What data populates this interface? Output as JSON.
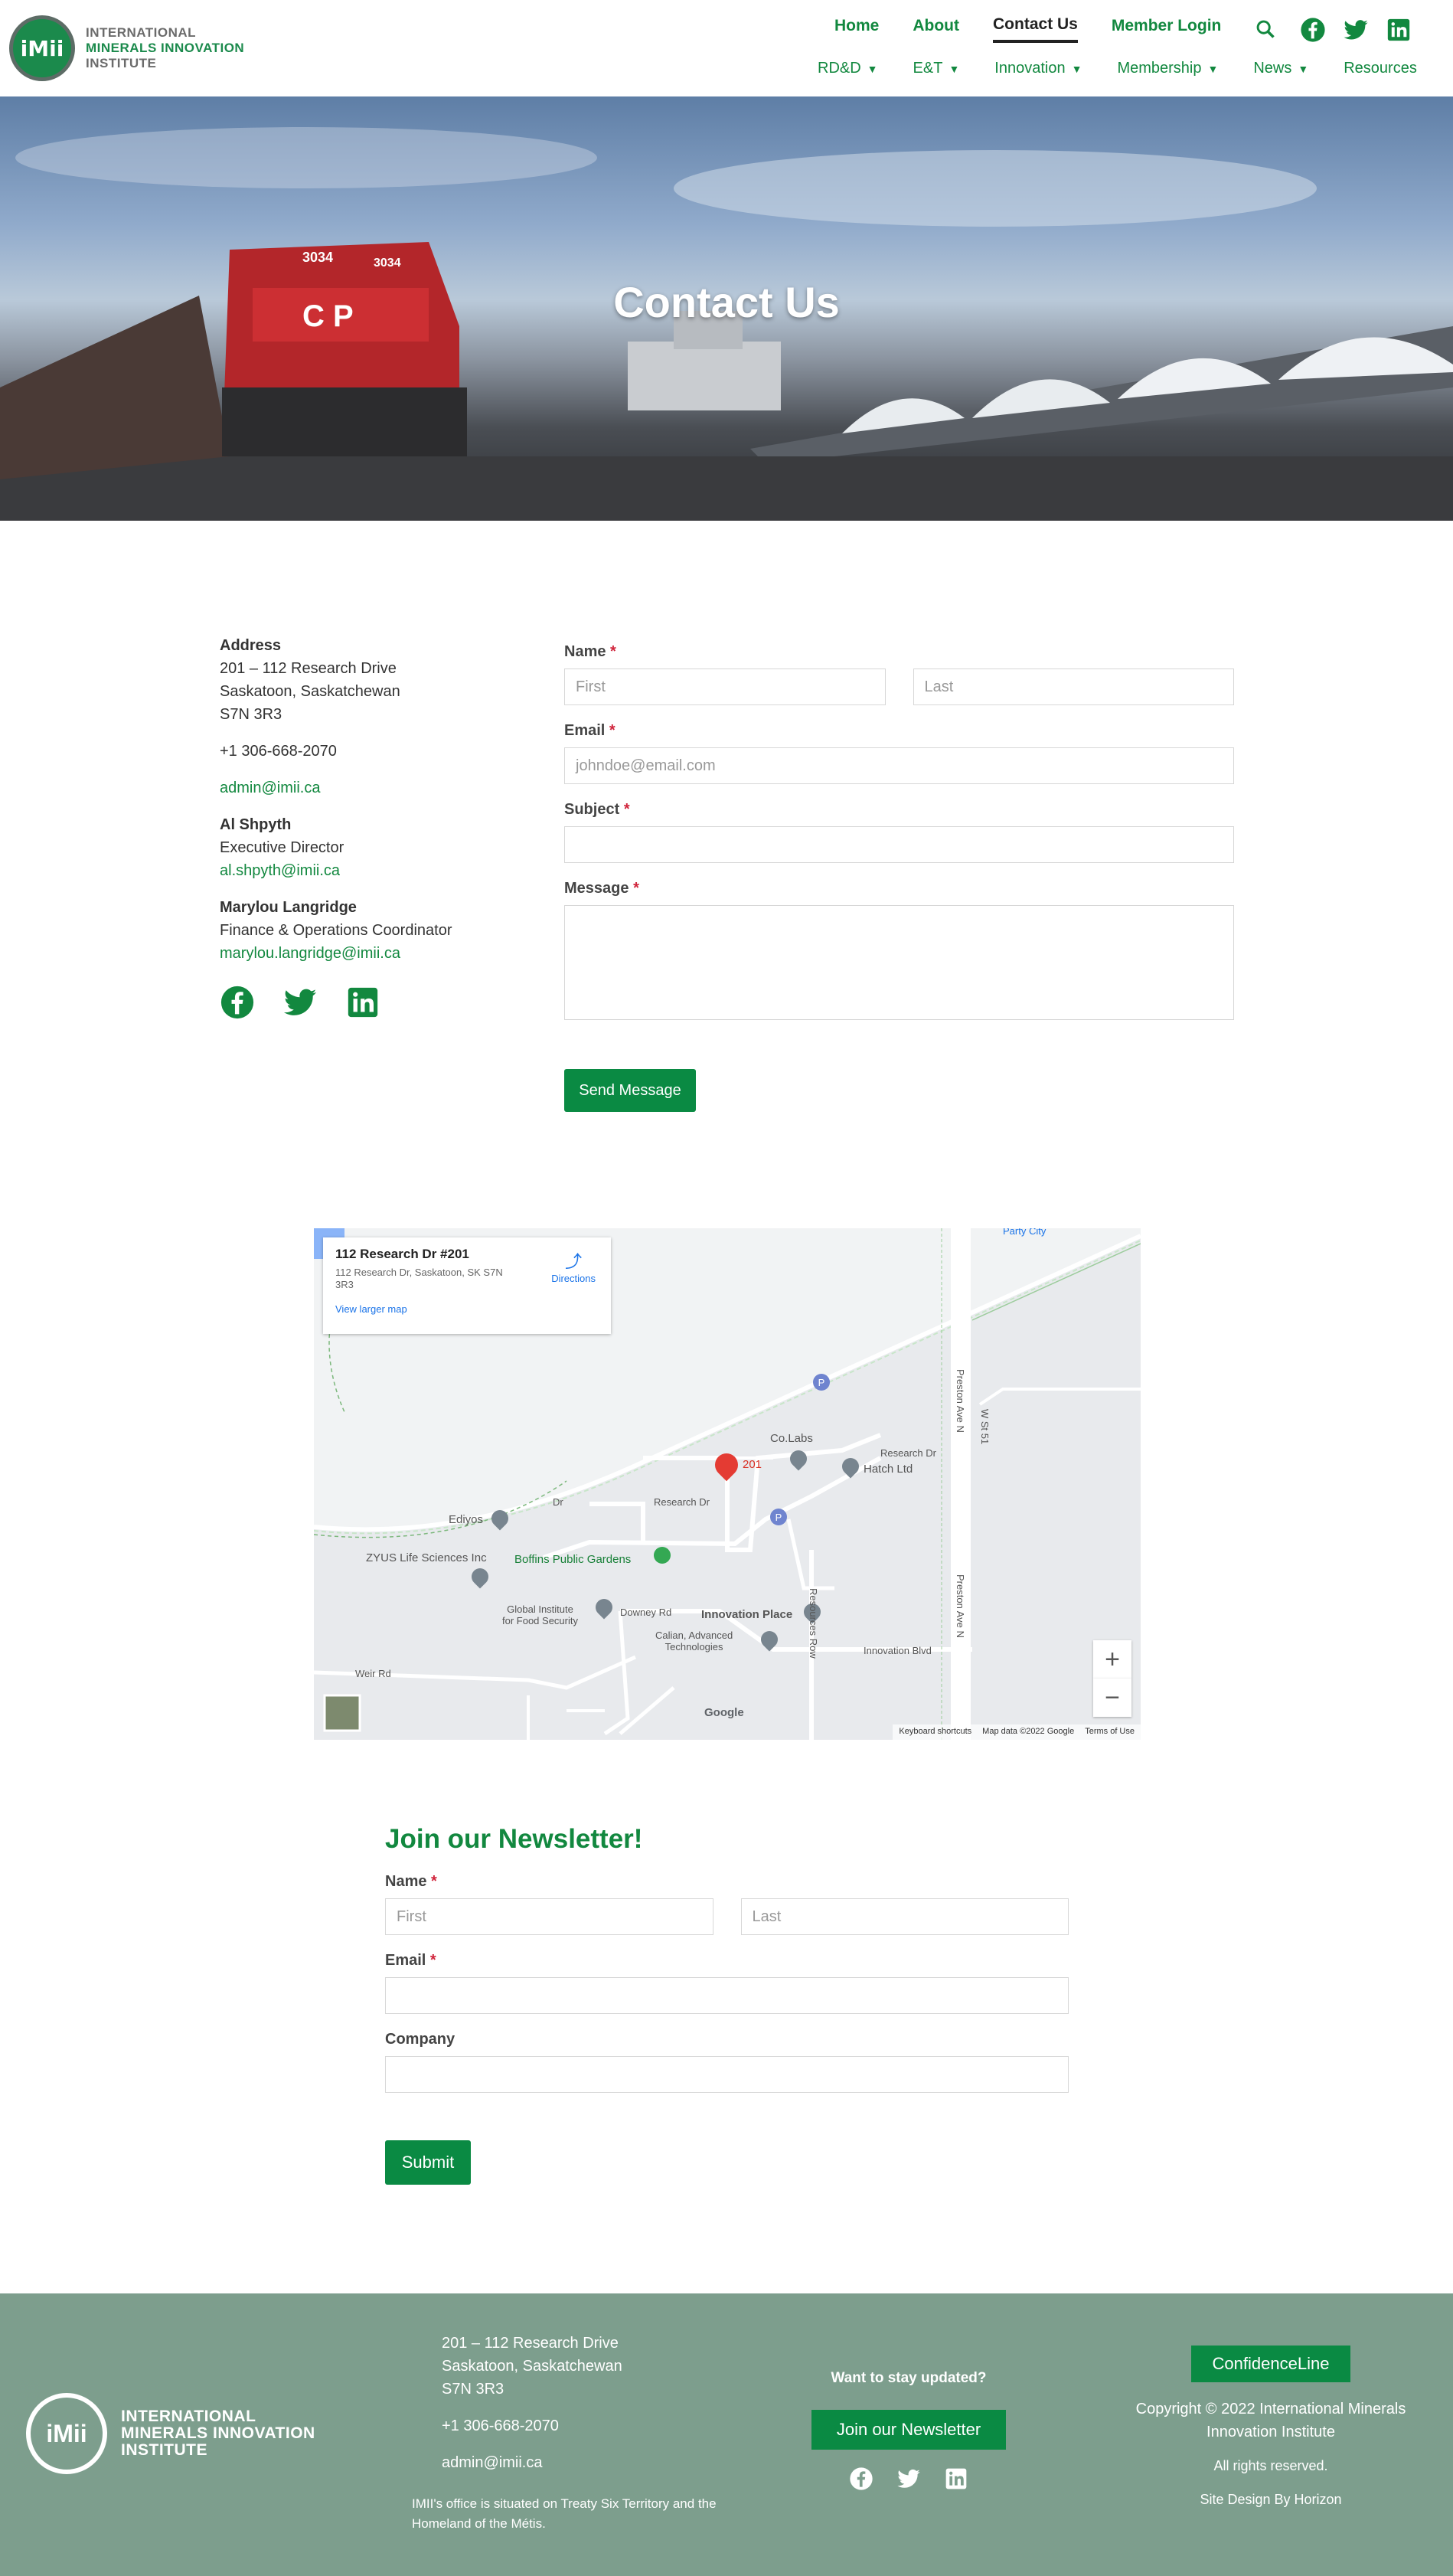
{
  "header": {
    "logo": {
      "line1": "INTERNATIONAL",
      "line2": "MINERALS INNOVATION",
      "line3": "INSTITUTE",
      "mark": "iMii"
    },
    "nav_top": [
      "Home",
      "About",
      "Contact Us",
      "Member Login"
    ],
    "nav_active": "Contact Us",
    "nav_bottom": [
      {
        "label": "RD&D",
        "has_dropdown": true
      },
      {
        "label": "E&T",
        "has_dropdown": true
      },
      {
        "label": "Innovation",
        "has_dropdown": true
      },
      {
        "label": "Membership",
        "has_dropdown": true
      },
      {
        "label": "News",
        "has_dropdown": true
      },
      {
        "label": "Resources",
        "has_dropdown": false
      }
    ],
    "icons": [
      "search-icon",
      "facebook-icon",
      "twitter-icon",
      "linkedin-icon"
    ],
    "accent_color": "#12883f"
  },
  "hero": {
    "title": "Contact Us"
  },
  "contact": {
    "address_label": "Address",
    "address_line1": "201 – 112 Research Drive",
    "address_line2": "Saskatoon, Saskatchewan",
    "address_line3": "S7N 3R3",
    "phone": "+1 306-668-2070",
    "email": "admin@imii.ca",
    "person1_name": "Al Shpyth",
    "person1_title": "Executive Director",
    "person1_email": "al.shpyth@imii.ca",
    "person2_name": "Marylou Langridge",
    "person2_title": "Finance & Operations Coordinator",
    "person2_email": "marylou.langridge@imii.ca"
  },
  "contact_form": {
    "name_label": "Name",
    "first_placeholder": "First",
    "last_placeholder": "Last",
    "email_label": "Email",
    "email_placeholder": "johndoe@email.com",
    "subject_label": "Subject",
    "message_label": "Message",
    "required_mark": "*",
    "send_label": "Send Message"
  },
  "map": {
    "card_title": "112 Research Dr #201",
    "card_address": "112 Research Dr, Saskatoon, SK S7N 3R3",
    "directions_label": "Directions",
    "view_larger": "View larger map",
    "labels": {
      "party_city": "Party City",
      "colabs": "Co.Labs",
      "pin_201": "201",
      "research_dr": "Research Dr",
      "research_dr2": "Research Dr",
      "hatch": "Hatch Ltd",
      "ediyos": "Ediyos",
      "zyus": "ZYUS Life Sciences Inc",
      "boffins": "Boffins Public Gardens",
      "global_institute": "Global Institute\nfor Food Security",
      "downey_rd": "Downey Rd",
      "innovation_place": "Innovation Place",
      "calian": "Calian, Advanced\nTechnologies",
      "innovation_blvd": "Innovation Blvd",
      "resources_row": "Resources Row",
      "preston_ave_n1": "Preston Ave N",
      "preston_ave_n2": "Preston Ave N",
      "st_w": "W St 51",
      "weir_rd": "Weir Rd",
      "dr_short": "Dr"
    },
    "parking_label": "P",
    "google": "Google",
    "keyboard_shortcuts": "Keyboard shortcuts",
    "map_data": "Map data ©2022 Google",
    "terms": "Terms of Use",
    "zoom_in": "+",
    "zoom_out": "−"
  },
  "newsletter": {
    "title": "Join our Newsletter!",
    "name_label": "Name",
    "first_placeholder": "First",
    "last_placeholder": "Last",
    "email_label": "Email",
    "company_label": "Company",
    "required_mark": "*",
    "submit_label": "Submit"
  },
  "footer": {
    "logo_line1": "INTERNATIONAL",
    "logo_line2": "MINERALS INNOVATION",
    "logo_line3": "INSTITUTE",
    "logo_mark": "iMii",
    "address_line1": "201 – 112 Research Drive",
    "address_line2": "Saskatoon, Saskatchewan",
    "address_line3": "S7N 3R3",
    "phone": "+1 306-668-2070",
    "email": "admin@imii.ca",
    "acknowledgement": "IMII's office is situated on Treaty Six Territory and the Homeland of the Métis.",
    "stay_updated": "Want to stay updated?",
    "join_label": "Join our Newsletter",
    "confidence_label": "ConfidenceLine",
    "copyright": "Copyright © 2022 International Minerals Innovation Institute",
    "rights": "All rights reserved.",
    "design": "Site Design By Horizon",
    "bg_color": "#7d9e8d"
  }
}
